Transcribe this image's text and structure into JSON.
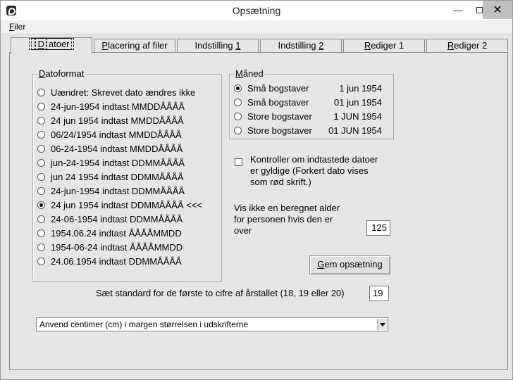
{
  "window": {
    "title": "Opsætning"
  },
  "menu": {
    "filer_first": "F",
    "filer_rest": "iler"
  },
  "tabs": [
    {
      "pre": "",
      "u": "D",
      "post": "atoer"
    },
    {
      "pre": "",
      "u": "P",
      "post": "lacering af filer"
    },
    {
      "pre": "Indstilling ",
      "u": "1",
      "post": ""
    },
    {
      "pre": "Indstilling ",
      "u": "2",
      "post": ""
    },
    {
      "pre": "",
      "u": "R",
      "post": "ediger 1"
    },
    {
      "pre": "",
      "u": "R",
      "post": "ediger 2"
    }
  ],
  "datoformat": {
    "title": "Datoformat",
    "options": [
      "Uændret: Skrevet dato ændres ikke",
      "24-jun-1954 indtast MMDDÅÅÅÅ",
      "24 jun 1954 indtast MMDDÅÅÅÅ",
      "06/24/1954 indtast MMDDÅÅÅÅ",
      "06-24-1954 indtast MMDDÅÅÅÅ",
      "jun-24-1954 indtast DDMMÅÅÅÅ",
      "jun 24 1954 indtast DDMMÅÅÅÅ",
      "24-jun-1954 indtast DDMMÅÅÅÅ",
      "24 jun 1954 indtast DDMMÅÅÅÅ <<<",
      "24-06-1954 indtast DDMMÅÅÅÅ",
      "1954.06.24 indtast ÅÅÅÅMMDD",
      "1954-06-24 indtast ÅÅÅÅMMDD",
      "24.06.1954 indtast DDMMÅÅÅÅ"
    ],
    "selected_index": 8
  },
  "maaned": {
    "title": "Måned",
    "options": [
      {
        "label": "Små bogstaver",
        "example": "1 jun 1954"
      },
      {
        "label": "Små bogstaver",
        "example": "01 jun 1954"
      },
      {
        "label": "Store bogstaver",
        "example": "1 JUN 1954"
      },
      {
        "label": "Store bogstaver",
        "example": "01 JUN 1954"
      }
    ],
    "selected_index": 0
  },
  "kontroller": {
    "line1": "Kontroller om indtastede datoer",
    "line2": "er gyldige (Forkert dato vises",
    "line3": "som rød skrift.)",
    "checked": false
  },
  "alder": {
    "line1": "Vis ikke en beregnet alder",
    "line2": "for personen hvis den er",
    "line3": "over",
    "value": "125"
  },
  "gem_button": {
    "u": "G",
    "rest": "em opsætning"
  },
  "standard": {
    "label": "Sæt standard for de første to cifre af årstallet (18, 19 eller 20)",
    "value": "19"
  },
  "margin_select": {
    "value": "Anvend centimer (cm) i margen størrelsen i udskrifterne"
  }
}
